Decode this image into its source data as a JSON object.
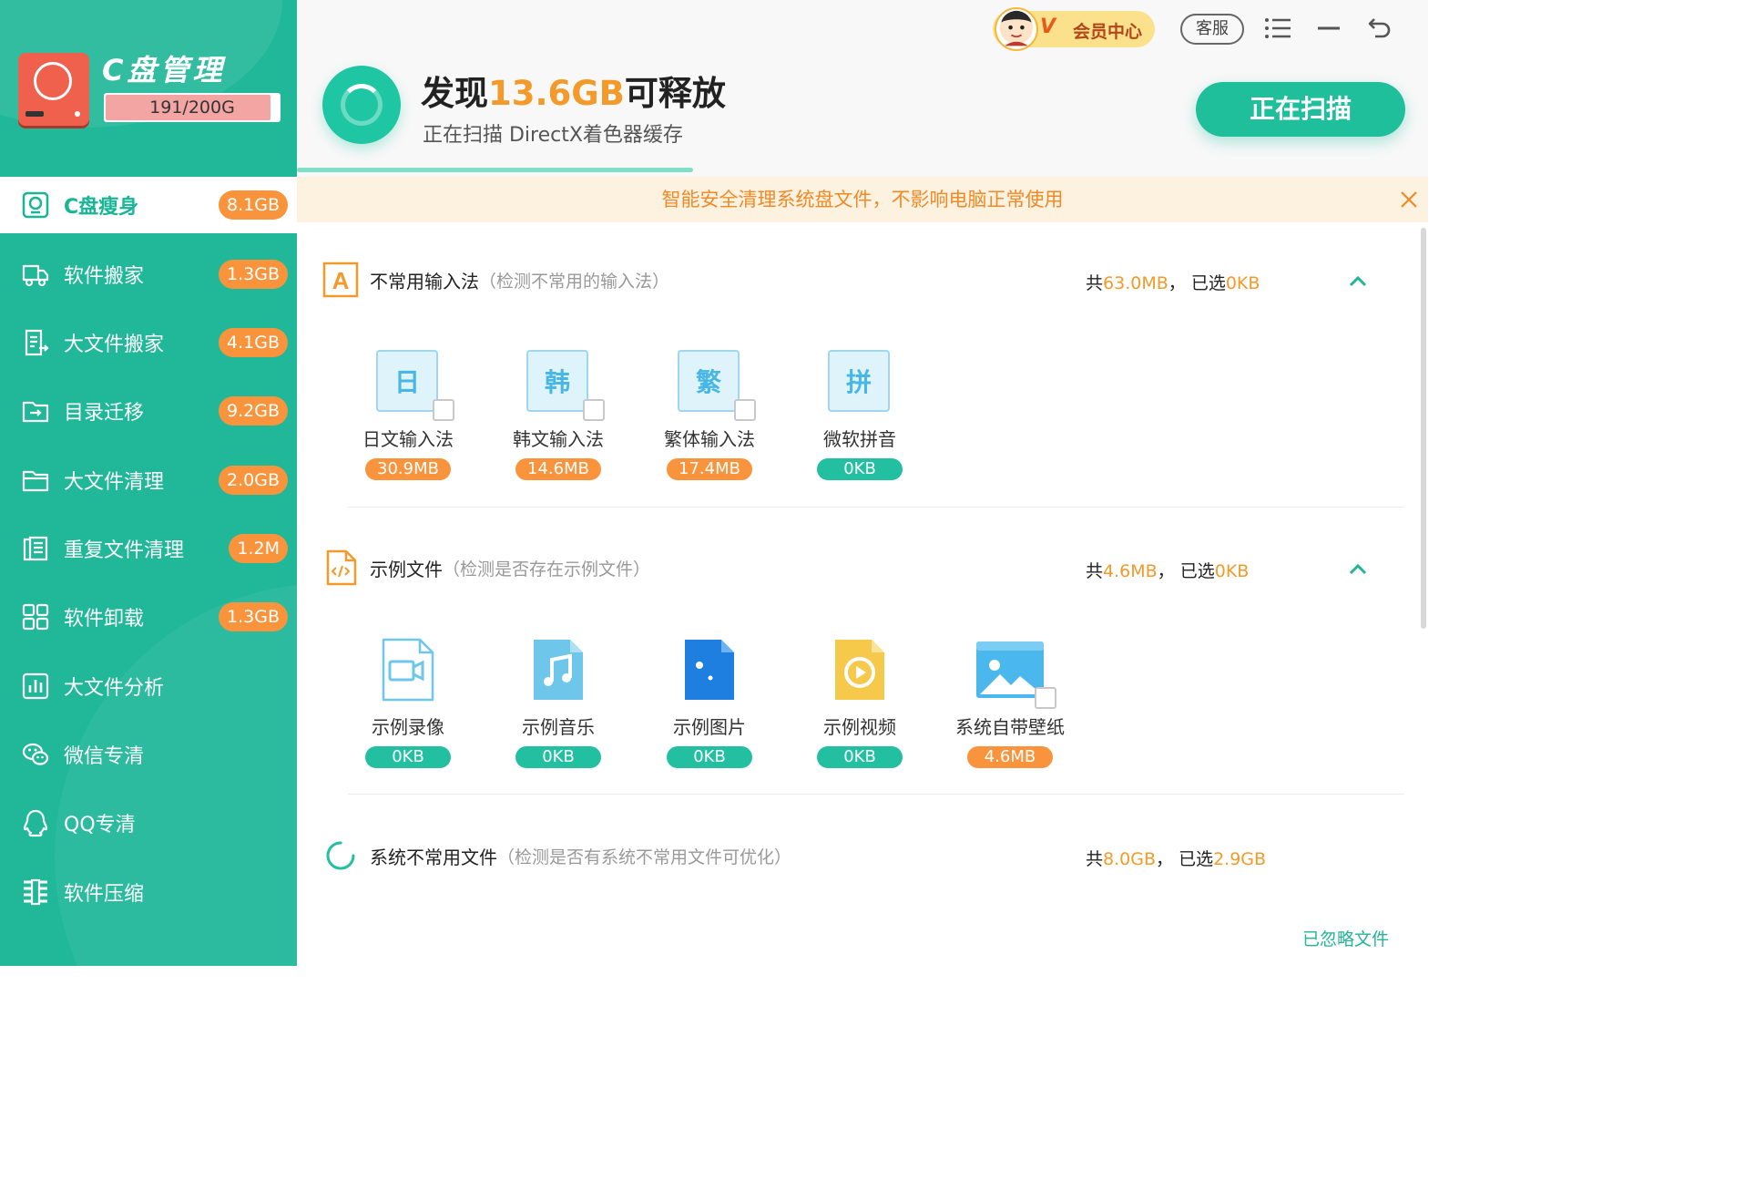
{
  "app": {
    "title": "C盘管理",
    "capacity": "191/200G",
    "capacity_ratio": 0.955
  },
  "nav": [
    {
      "label": "C盘瘦身",
      "badge": "8.1GB",
      "icon": "disk-slim-icon",
      "active": true
    },
    {
      "label": "软件搬家",
      "badge": "1.3GB",
      "icon": "truck-icon"
    },
    {
      "label": "大文件搬家",
      "badge": "4.1GB",
      "icon": "file-move-icon"
    },
    {
      "label": "目录迁移",
      "badge": "9.2GB",
      "icon": "folder-move-icon"
    },
    {
      "label": "大文件清理",
      "badge": "2.0GB",
      "icon": "folder-icon"
    },
    {
      "label": "重复文件清理",
      "badge": "1.2M",
      "icon": "duplicate-file-icon"
    },
    {
      "label": "软件卸载",
      "badge": "1.3GB",
      "icon": "apps-grid-icon"
    },
    {
      "label": "大文件分析",
      "badge": "",
      "icon": "bar-chart-icon"
    },
    {
      "label": "微信专清",
      "badge": "",
      "icon": "wechat-icon"
    },
    {
      "label": "QQ专清",
      "badge": "",
      "icon": "qq-icon"
    },
    {
      "label": "软件压缩",
      "badge": "",
      "icon": "compress-icon"
    }
  ],
  "topbar": {
    "vip_label": "会员中心",
    "vip_mark": "V",
    "service": "客服",
    "menu_icon": "menu-icon",
    "minimize_icon": "minimize-icon",
    "back_icon": "back-icon"
  },
  "scan": {
    "prefix": "发现",
    "amount": "13.6GB",
    "suffix": "可释放",
    "status": "正在扫描 DirectX着色器缓存",
    "button": "正在扫描",
    "progress": 0.35
  },
  "notice": "智能安全清理系统盘文件，不影响电脑正常使用",
  "sections": [
    {
      "title": "不常用输入法",
      "desc": "（检测不常用的输入法）",
      "total_prefix": "共",
      "total": "63.0MB",
      "sep": "，",
      "selected_prefix": "已选",
      "selected": "0KB",
      "items": [
        {
          "glyph": "日",
          "name": "日文输入法",
          "size": "30.9MB"
        },
        {
          "glyph": "韩",
          "name": "韩文输入法",
          "size": "14.6MB"
        },
        {
          "glyph": "繁",
          "name": "繁体输入法",
          "size": "17.4MB"
        },
        {
          "glyph": "拼",
          "name": "微软拼音",
          "size": "0KB"
        }
      ]
    },
    {
      "title": "示例文件",
      "desc": "（检测是否存在示例文件）",
      "total_prefix": "共",
      "total": "4.6MB",
      "sep": "，",
      "selected_prefix": "已选",
      "selected": "0KB",
      "items": [
        {
          "name": "示例录像",
          "size": "0KB",
          "icon": "video-file-icon"
        },
        {
          "name": "示例音乐",
          "size": "0KB",
          "icon": "music-file-icon"
        },
        {
          "name": "示例图片",
          "size": "0KB",
          "icon": "picture-file-icon"
        },
        {
          "name": "示例视频",
          "size": "0KB",
          "icon": "play-file-icon"
        },
        {
          "name": "系统自带壁纸",
          "size": "4.6MB",
          "icon": "wallpaper-icon"
        }
      ]
    },
    {
      "title": "系统不常用文件",
      "desc": "（检测是否有系统不常用文件可优化）",
      "total_prefix": "共",
      "total": "8.0GB",
      "sep": "，",
      "selected_prefix": "已选",
      "selected": "2.9GB"
    }
  ],
  "footer": {
    "ignored": "已忽略文件"
  },
  "colors": {
    "primary": "#21b89a",
    "orange": "#f9943d",
    "notice_bg": "#fdf1e0"
  }
}
